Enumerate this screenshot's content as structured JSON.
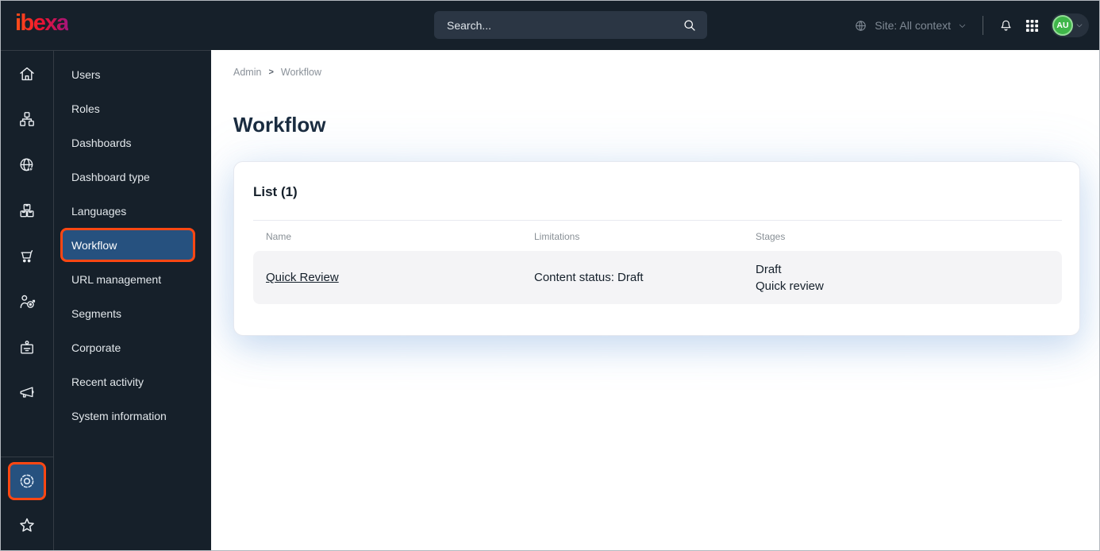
{
  "topbar": {
    "logo_text": "ibexa",
    "search_placeholder": "Search...",
    "site_selector_label": "Site: All context",
    "avatar_initials": "AU",
    "icons": [
      "site-globe-icon",
      "chevron-down-icon",
      "bell-icon",
      "app-grid-icon",
      "search-icon",
      "avatar-chevron-down-icon"
    ]
  },
  "icon_rail": {
    "items": [
      {
        "icon": "home-icon"
      },
      {
        "icon": "content-tree-icon"
      },
      {
        "icon": "site-globe-cursor-icon"
      },
      {
        "icon": "product-catalog-icon"
      },
      {
        "icon": "cart-icon"
      },
      {
        "icon": "customers-target-icon"
      },
      {
        "icon": "corporate-badge-icon"
      },
      {
        "icon": "megaphone-icon"
      }
    ],
    "bottom_items": [
      {
        "icon": "settings-gear-icon",
        "selected": true,
        "highlighted": true
      },
      {
        "icon": "star-icon"
      }
    ]
  },
  "sidebar": {
    "items": [
      {
        "label": "Users"
      },
      {
        "label": "Roles"
      },
      {
        "label": "Dashboards"
      },
      {
        "label": "Dashboard type"
      },
      {
        "label": "Languages"
      },
      {
        "label": "Workflow",
        "selected": true,
        "highlighted": true
      },
      {
        "label": "URL management"
      },
      {
        "label": "Segments"
      },
      {
        "label": "Corporate"
      },
      {
        "label": "Recent activity"
      },
      {
        "label": "System information"
      }
    ]
  },
  "breadcrumb": {
    "items": [
      "Admin",
      "Workflow"
    ],
    "separator": ">"
  },
  "page": {
    "title": "Workflow"
  },
  "list_card": {
    "title": "List (1)",
    "columns": [
      "Name",
      "Limitations",
      "Stages"
    ],
    "rows": [
      {
        "name": "Quick Review",
        "limitations": "Content status: Draft",
        "stages": [
          "Draft",
          "Quick review"
        ]
      }
    ]
  },
  "colors": {
    "topbar_bg": "#16202a",
    "selected_bg": "#26517f",
    "highlight": "#ff4713",
    "avatar_bg": "#3fb649",
    "row_bg": "#f4f4f6",
    "title_color": "#1a2c40",
    "logo_from": "#ff5117",
    "logo_mid": "#ee1330",
    "logo_to": "#a3157b"
  }
}
